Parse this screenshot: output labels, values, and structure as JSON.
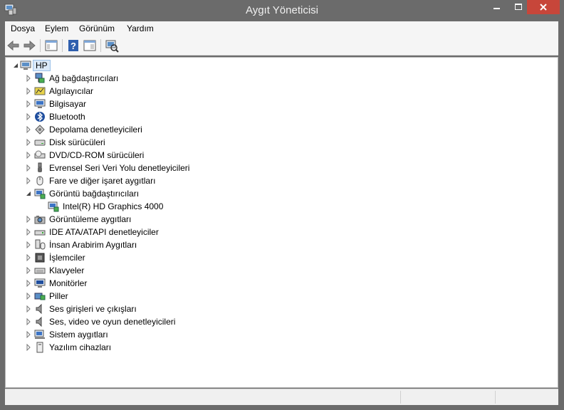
{
  "window": {
    "title": "Aygıt Yöneticisi"
  },
  "menu": [
    "Dosya",
    "Eylem",
    "Görünüm",
    "Yardım"
  ],
  "tree": {
    "root": "HP",
    "categories": [
      {
        "label": "Ağ bağdaştırıcıları",
        "icon": "network-adapter-icon"
      },
      {
        "label": "Algılayıcılar",
        "icon": "sensor-icon"
      },
      {
        "label": "Bilgisayar",
        "icon": "computer-icon"
      },
      {
        "label": "Bluetooth",
        "icon": "bluetooth-icon"
      },
      {
        "label": "Depolama denetleyicileri",
        "icon": "storage-controller-icon"
      },
      {
        "label": "Disk sürücüleri",
        "icon": "disk-drive-icon"
      },
      {
        "label": "DVD/CD-ROM sürücüleri",
        "icon": "dvd-drive-icon"
      },
      {
        "label": "Evrensel Seri Veri Yolu denetleyicileri",
        "icon": "usb-icon"
      },
      {
        "label": "Fare ve diğer işaret aygıtları",
        "icon": "mouse-icon"
      },
      {
        "label": "Görüntü bağdaştırıcıları",
        "icon": "display-adapter-icon",
        "expanded": true,
        "children": [
          {
            "label": "Intel(R) HD Graphics 4000",
            "icon": "display-adapter-icon"
          }
        ]
      },
      {
        "label": "Görüntüleme aygıtları",
        "icon": "imaging-device-icon"
      },
      {
        "label": "IDE ATA/ATAPI denetleyiciler",
        "icon": "ide-controller-icon"
      },
      {
        "label": "İnsan Arabirim Aygıtları",
        "icon": "hid-icon"
      },
      {
        "label": "İşlemciler",
        "icon": "processor-icon"
      },
      {
        "label": "Klavyeler",
        "icon": "keyboard-icon"
      },
      {
        "label": "Monitörler",
        "icon": "monitor-icon"
      },
      {
        "label": "Piller",
        "icon": "battery-icon"
      },
      {
        "label": "Ses girişleri ve çıkışları",
        "icon": "speaker-icon"
      },
      {
        "label": "Ses, video ve oyun denetleyicileri",
        "icon": "speaker-icon"
      },
      {
        "label": "Sistem aygıtları",
        "icon": "system-device-icon"
      },
      {
        "label": "Yazılım cihazları",
        "icon": "software-device-icon"
      }
    ]
  },
  "colors": {
    "chrome": "#6b6b6b",
    "close": "#c7463a",
    "selection": "#dbe9f9"
  }
}
